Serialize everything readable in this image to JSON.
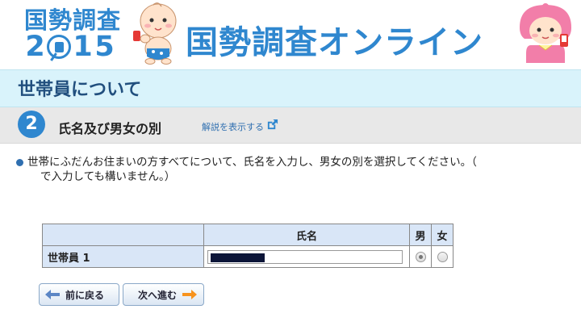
{
  "header": {
    "logo_title": "国勢調査",
    "logo_year_digits": [
      "2",
      "1",
      "5"
    ],
    "app_title": "国勢調査オンライン"
  },
  "section": {
    "title": "世帯員について"
  },
  "step": {
    "number": "2",
    "title": "氏名及び男女の別",
    "help_link": "解説を表示する"
  },
  "instruction": {
    "line1": "世帯にふだんお住まいの方すべてについて、氏名を入力し、男女の別を選択してください。（",
    "line2": "で入力しても構いません。）"
  },
  "table": {
    "headers": {
      "label": "",
      "name": "氏名",
      "male": "男",
      "female": "女"
    },
    "rows": [
      {
        "label": "世帯員 1",
        "name_value": "",
        "sex": "male"
      }
    ]
  },
  "nav": {
    "prev_label": "前に戻る",
    "next_label": "次へ進む"
  },
  "colors": {
    "brand_blue": "#2f87cf",
    "section_bg": "#d9f3fb",
    "next_arrow": "#f7931e",
    "prev_arrow": "#5b86c5"
  }
}
